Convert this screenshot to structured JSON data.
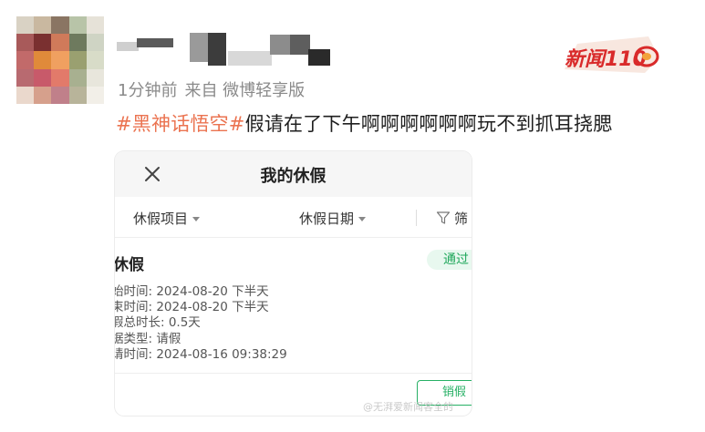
{
  "post": {
    "meta_time": "1分钟前",
    "meta_source": "来自 微博轻享版",
    "hashtag": "#黑神话悟空#",
    "text": "假请在了下午啊啊啊啊啊啊玩不到抓耳挠腮"
  },
  "logo": {
    "text": "新闻110",
    "colors": {
      "primary": "#d92a2a",
      "accent": "#f2a23a"
    }
  },
  "app": {
    "title": "我的休假",
    "filters": {
      "type_label": "休假项目",
      "date_label": "休假日期",
      "filter_label": "筛"
    },
    "record": {
      "title": "休假",
      "status": "通过",
      "lines": [
        "始时间: 2024-08-20 下半天",
        "束时间: 2024-08-20 下半天",
        "假总时长: 0.5天",
        "据类型: 请假",
        "请时间: 2024-08-16 09:38:29"
      ],
      "action": "销假"
    },
    "watermark": "@无湃爱新闻客全的"
  },
  "colors": {
    "hashtag": "#eb7350",
    "status_green": "#1fa75b",
    "meta_gray": "#8a8a8a"
  }
}
